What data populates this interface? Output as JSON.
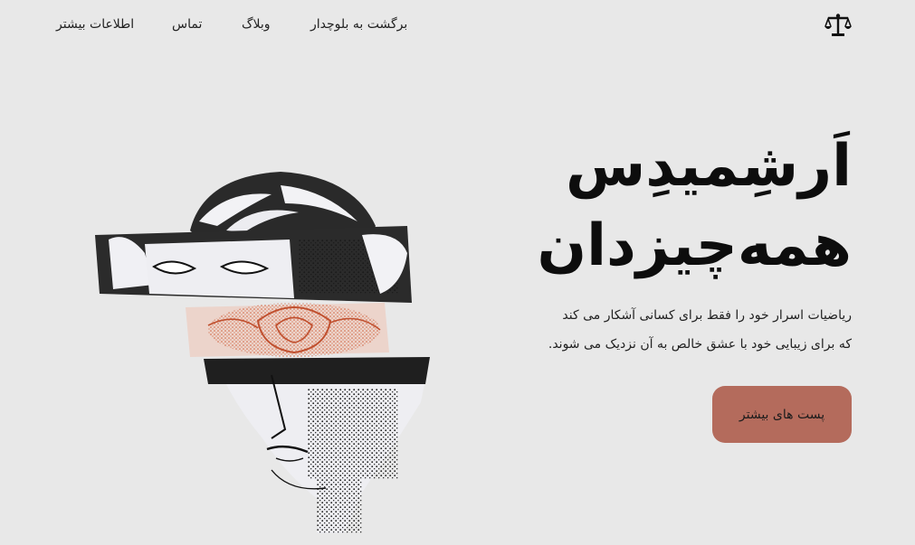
{
  "nav": {
    "more_info": "اطلاعات بیشتر",
    "contact": "تماس",
    "blog": "وبلاگ",
    "back": "برگشت به بلوچدار",
    "logo_icon": "scales-icon"
  },
  "hero": {
    "title_line1": "اَرشِمیدِس",
    "title_line2": "همه‌چیزدان",
    "text_line1": "ریاضیات اسرار خود را فقط برای کسانی آشکار می کند",
    "text_line2": "که برای زیبایی خود با عشق خالص به آن نزدیک می شوند.",
    "cta_label": "پست های بیشتر",
    "image": "sculpture-head-with-rose-illustration"
  },
  "colors": {
    "background": "#e8e8e8",
    "button": "#b46b5c",
    "rose": "#d0623f"
  }
}
